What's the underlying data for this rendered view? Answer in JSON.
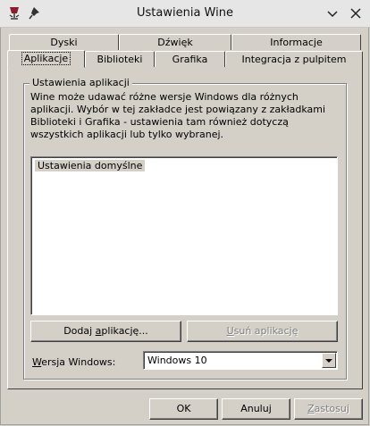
{
  "window": {
    "title": "Ustawienia Wine",
    "icons": {
      "app": "wine-glass-icon",
      "pin": "pin-icon",
      "minimize": "chevron-down-icon",
      "close": "close-icon"
    }
  },
  "tabs": {
    "row1": [
      {
        "label": "Dyski"
      },
      {
        "label": "Dźwięk"
      },
      {
        "label": "Informacje"
      }
    ],
    "row2": [
      {
        "label": "Aplikacje",
        "active": true
      },
      {
        "label": "Biblioteki"
      },
      {
        "label": "Grafika"
      },
      {
        "label": "Integracja z pulpitem"
      }
    ]
  },
  "group": {
    "label": "Ustawienia aplikacji",
    "description": "Wine może udawać różne wersje Windows dla różnych aplikacji. Wybór w tej zakładce jest powiązany z zakładkami Biblioteki i Grafika - ustawienia tam również dotyczą wszystkich aplikacji lub tylko wybranej.",
    "list_items": [
      "Ustawienia domyślne"
    ],
    "add_button": {
      "pre": "Dodaj ",
      "key": "a",
      "post": "plikację..."
    },
    "remove_button": {
      "pre": "",
      "key": "U",
      "post": "suń aplikację"
    },
    "version_label": {
      "pre": "",
      "key": "W",
      "post": "ersja Windows:"
    },
    "version_value": "Windows 10"
  },
  "footer": {
    "ok": "OK",
    "cancel": "Anuluj",
    "apply": {
      "pre": "",
      "key": "Z",
      "post": "astosuj"
    }
  },
  "colors": {
    "face": "#d4d0c8",
    "highlight": "#ffffff",
    "shadow": "#808080",
    "dark": "#404040",
    "disabled": "#808080"
  }
}
